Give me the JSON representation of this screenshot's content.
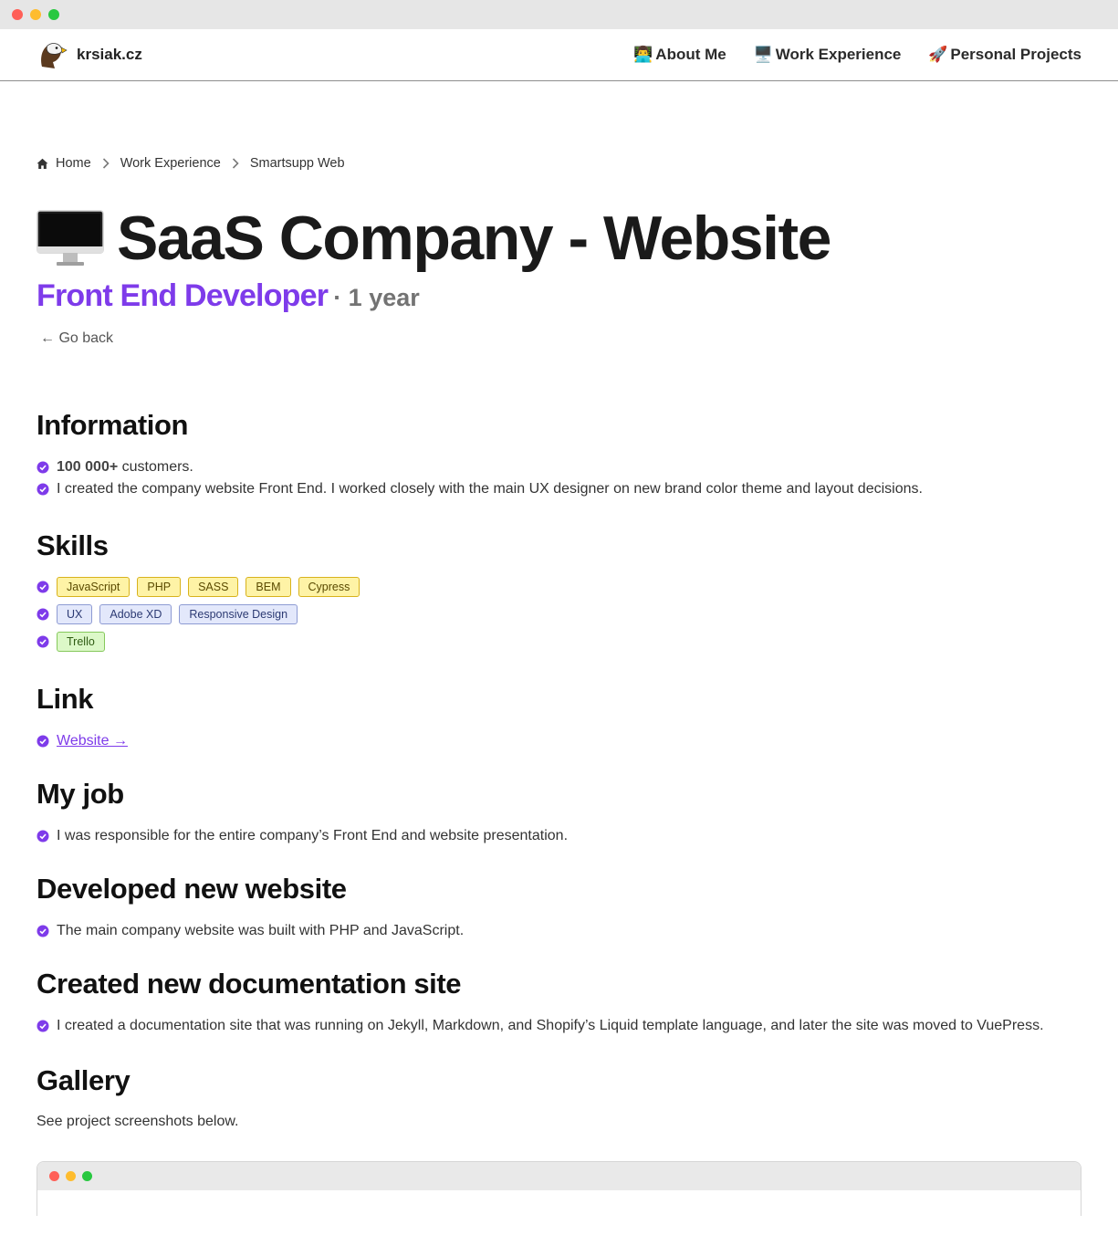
{
  "site": {
    "name": "krsiak.cz",
    "logo_icon": "eagle-icon"
  },
  "nav": {
    "links": [
      {
        "emoji": "👨‍💻",
        "label": "About Me"
      },
      {
        "emoji": "🖥️",
        "label": "Work Experience"
      },
      {
        "emoji": "🚀",
        "label": "Personal Projects"
      }
    ]
  },
  "breadcrumb": {
    "home": "Home",
    "work": "Work Experience",
    "current": "Smartsupp Web"
  },
  "header": {
    "title": "SaaS Company - Website",
    "title_icon": "desktop-computer-icon",
    "role": "Front End Developer",
    "duration": "· 1 year",
    "go_back": "← Go back"
  },
  "information": {
    "heading": "Information",
    "items": [
      {
        "bold": "100 000+",
        "text": " customers."
      },
      {
        "bold": "",
        "text": "I created the company website Front End. I worked closely with the main UX designer on new brand color theme and layout decisions."
      }
    ]
  },
  "skills": {
    "heading": "Skills",
    "rows": [
      {
        "color": "yellow",
        "tags": [
          "JavaScript",
          "PHP",
          "SASS",
          "BEM",
          "Cypress"
        ]
      },
      {
        "color": "blue",
        "tags": [
          "UX",
          "Adobe XD",
          "Responsive Design"
        ]
      },
      {
        "color": "green",
        "tags": [
          "Trello"
        ]
      }
    ]
  },
  "link": {
    "heading": "Link",
    "label": "Website →"
  },
  "my_job": {
    "heading": "My job",
    "text": "I was responsible for the entire company’s Front End and website presentation."
  },
  "developed": {
    "heading": "Developed new website",
    "text": "The main company website was built with PHP and JavaScript."
  },
  "documentation": {
    "heading": "Created new documentation site",
    "text": "I created a documentation site that was running on Jekyll, Markdown, and Shopify’s Liquid template language, and later the site was moved to VuePress."
  },
  "gallery": {
    "heading": "Gallery",
    "text": "See project screenshots below."
  },
  "colors": {
    "accent": "#7e3bea",
    "tag_yellow": "#fef3a6",
    "tag_blue": "#e3e8fb",
    "tag_green": "#dcf8c8"
  }
}
